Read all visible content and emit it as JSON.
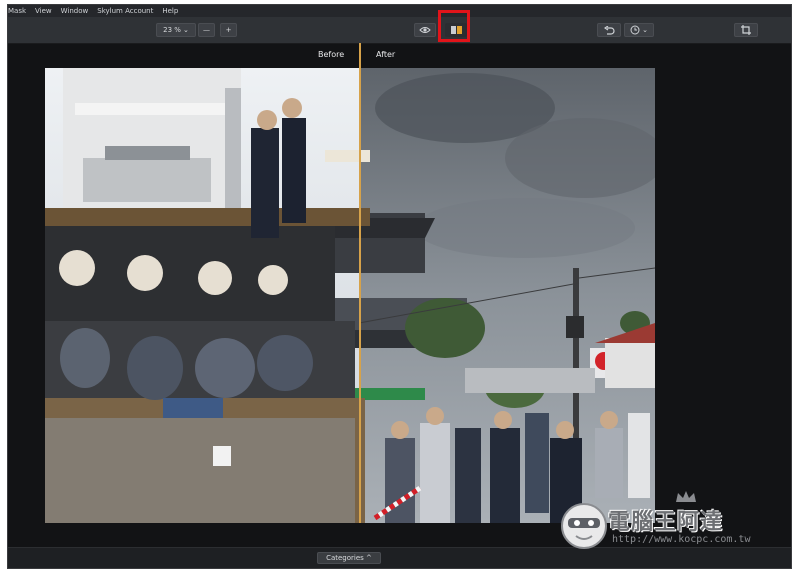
{
  "menu": [
    "Mask",
    "View",
    "Window",
    "Skylum Account",
    "Help"
  ],
  "toolbar": {
    "zoom_label": "23 %",
    "zoom_caret": "⌄",
    "zoom_out": "—",
    "zoom_in": "+",
    "preview_icon": "eye-icon",
    "compare_icon": "before-after-compare-icon",
    "undo_icon": "undo-icon",
    "history_icon": "history-clock-icon",
    "crop_icon": "crop-icon"
  },
  "compare": {
    "before_label": "Before",
    "after_label": "After",
    "divider_color": "#d6a24a"
  },
  "bottom": {
    "categories_label": "Categories ^"
  },
  "watermark": {
    "title": "電腦王阿達",
    "url": "http://www.kocpc.com.tw"
  },
  "colors": {
    "highlight": "#e1141a",
    "app_background": "#121315",
    "toolbar": "#2f3236"
  }
}
